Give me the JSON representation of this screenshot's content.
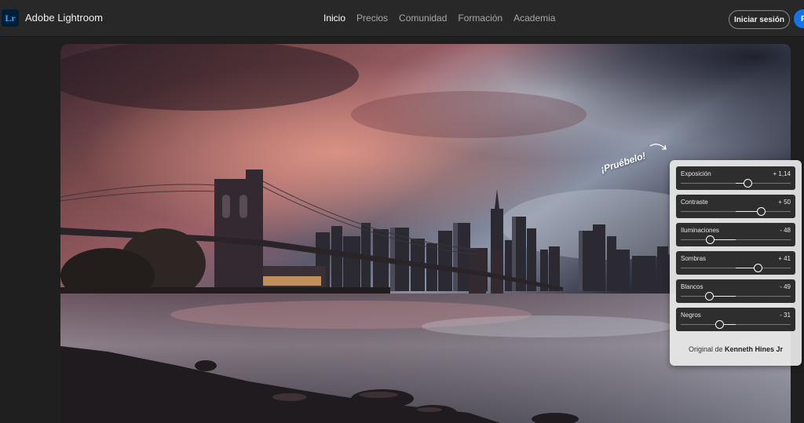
{
  "header": {
    "logo_text": "Lr",
    "app_name": "Adobe Lightroom",
    "nav": [
      {
        "label": "Inicio",
        "active": true
      },
      {
        "label": "Precios",
        "active": false
      },
      {
        "label": "Comunidad",
        "active": false
      },
      {
        "label": "Formación",
        "active": false
      },
      {
        "label": "Academia",
        "active": false
      }
    ],
    "signin_label": "Iniciar sesión",
    "primary_label": "P"
  },
  "photo": {
    "subject": "brooklyn-bridge-skyline-photo"
  },
  "try_label": "¡Pruébelo!",
  "panel": {
    "sliders": [
      {
        "label": "Exposición",
        "value_text": "+ 1,14",
        "position": 0.61
      },
      {
        "label": "Contraste",
        "value_text": "+ 50",
        "position": 0.73
      },
      {
        "label": "Iluminaciones",
        "value_text": "- 48",
        "position": 0.27
      },
      {
        "label": "Sombras",
        "value_text": "+ 41",
        "position": 0.7
      },
      {
        "label": "Blancos",
        "value_text": "- 49",
        "position": 0.26
      },
      {
        "label": "Negros",
        "value_text": "- 31",
        "position": 0.35
      }
    ],
    "credit_prefix": "Original de ",
    "credit_name": "Kenneth Hines Jr"
  },
  "colors": {
    "accent_blue": "#1473e6",
    "logo_bg": "#001e36",
    "logo_fg": "#31a8ff"
  }
}
